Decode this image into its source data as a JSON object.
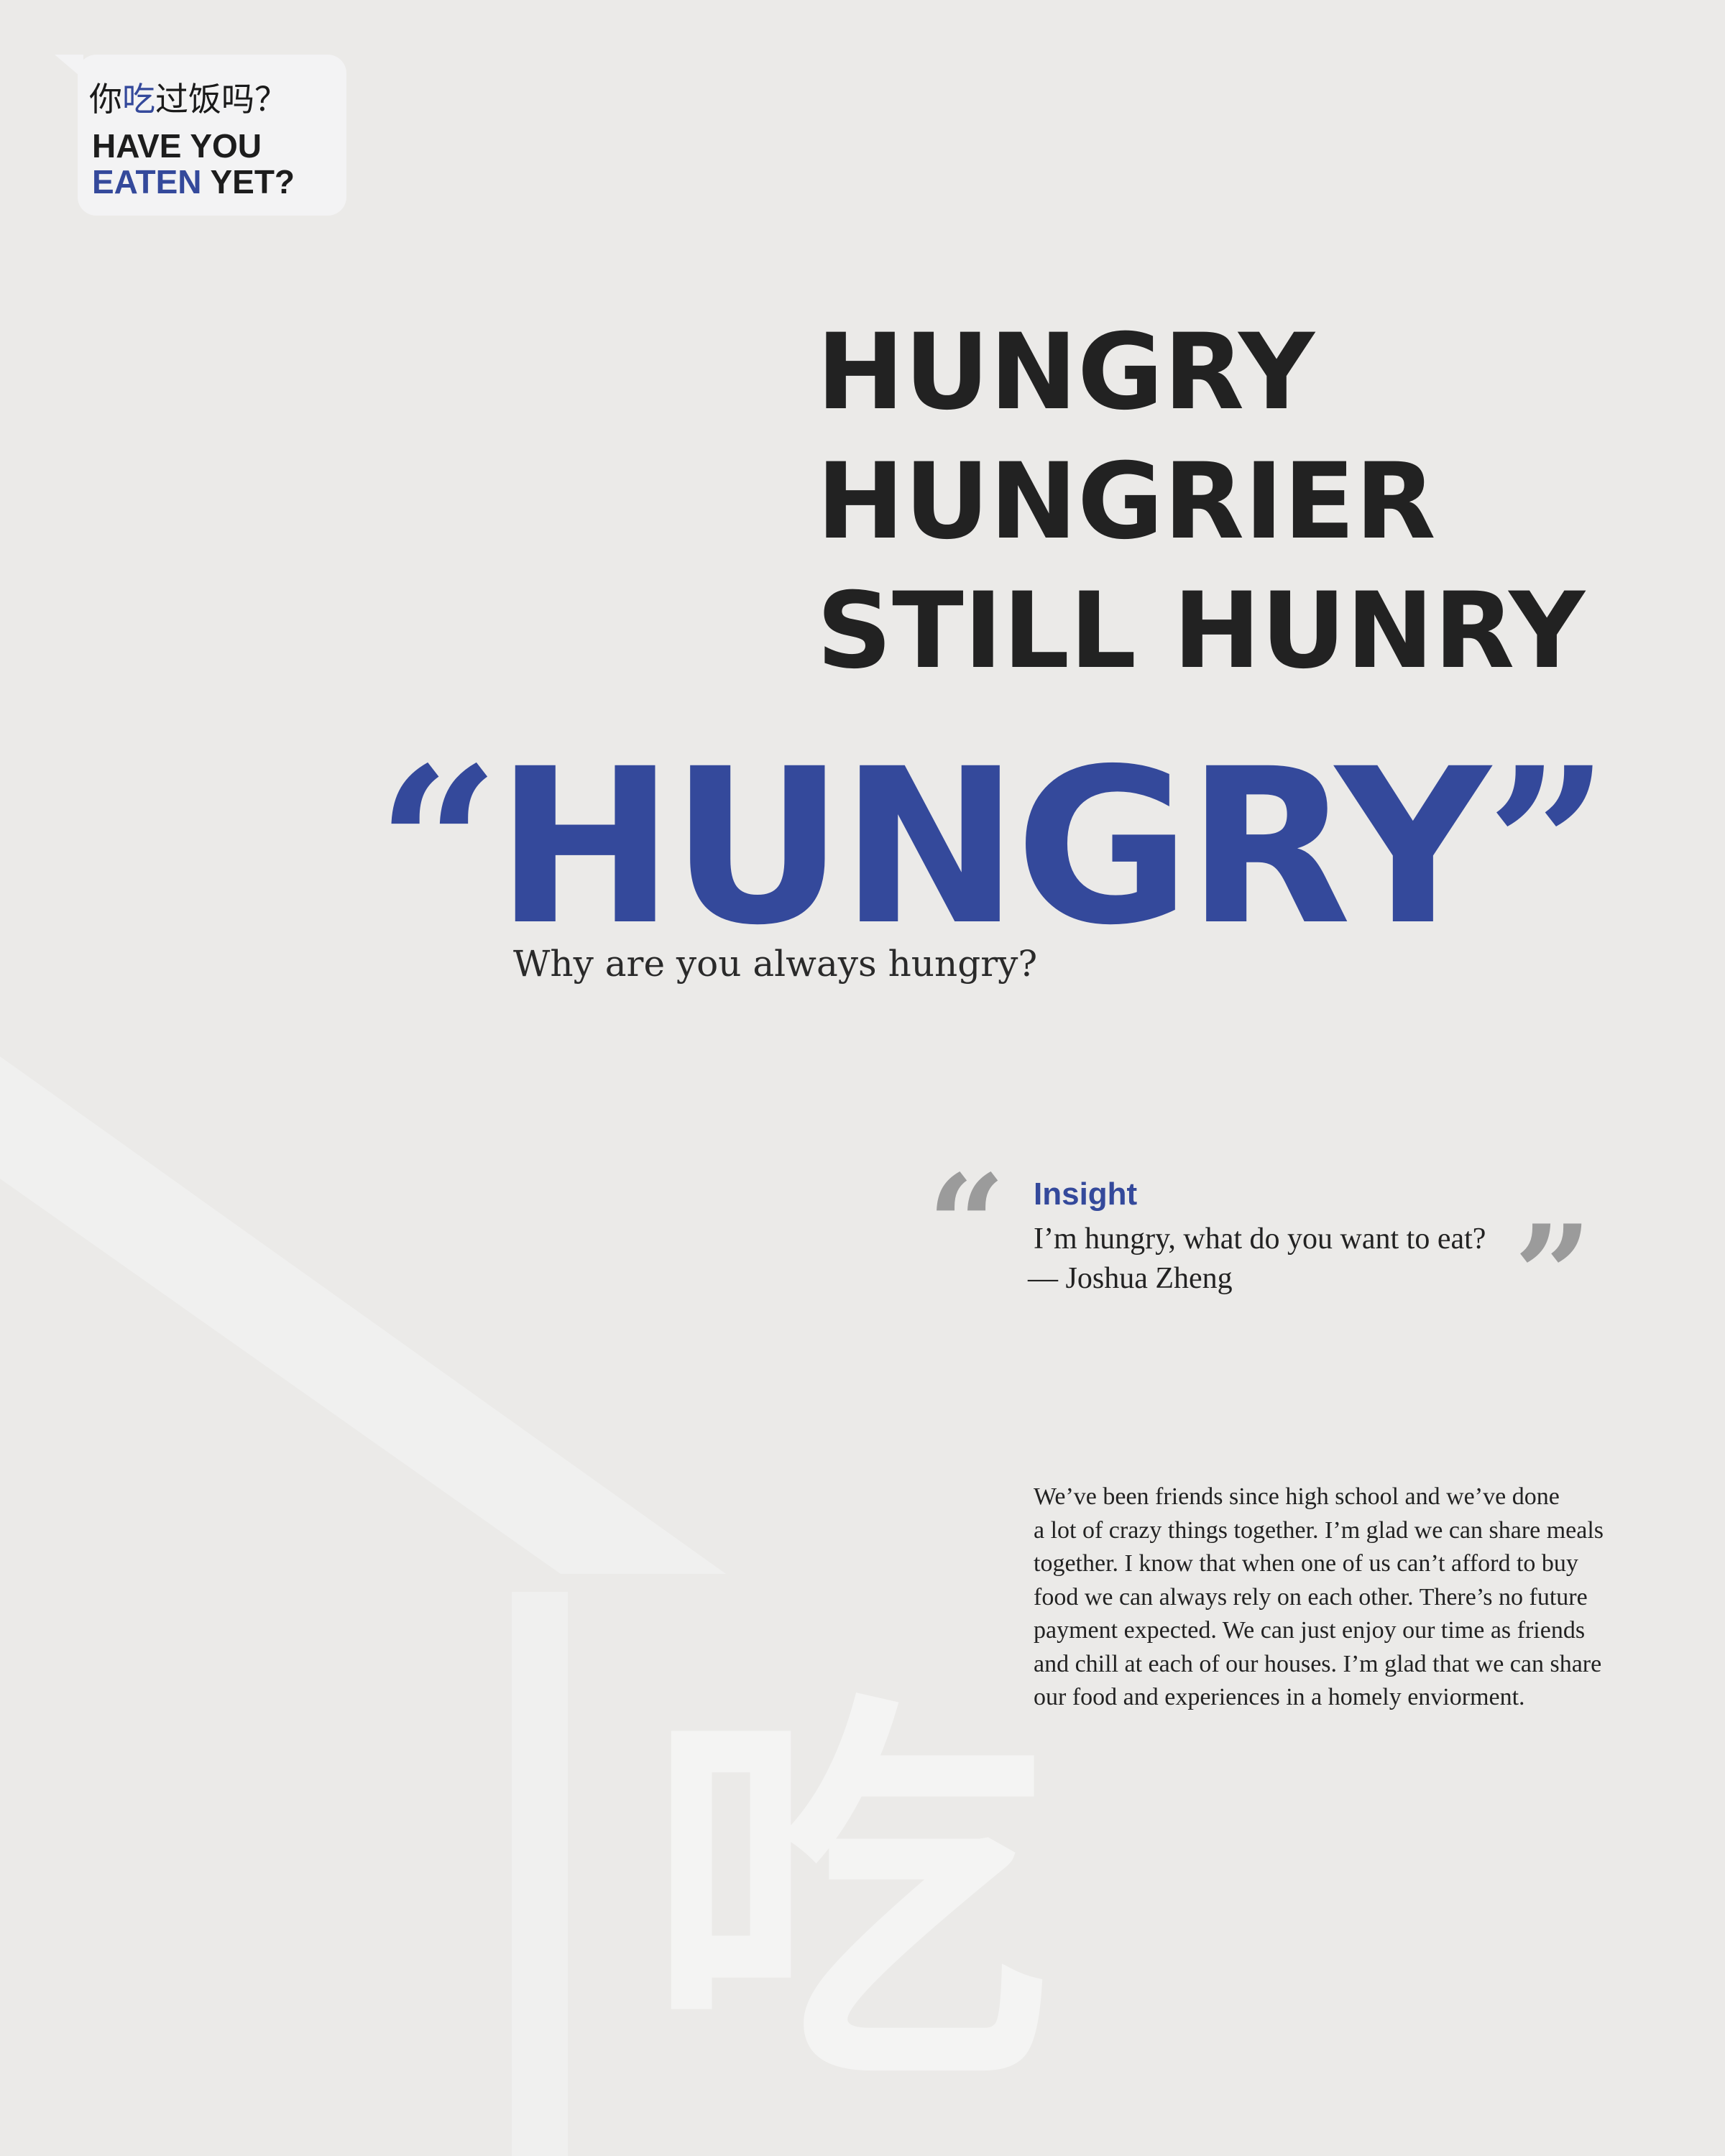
{
  "logo": {
    "chinese_parts": [
      "你",
      "吃",
      "过饭吗？"
    ],
    "english_line1": "HAVE YOU",
    "english_line2_accent": "EATEN",
    "english_line2_rest": " YET?"
  },
  "headline_stack": [
    "HUNGRY",
    "HUNGRIER",
    "STILL HUNRY"
  ],
  "big_quote": {
    "open_mark": "“",
    "word": "HUNGRY",
    "close_mark": "”"
  },
  "subtitle": "Why are you always hungry?",
  "insight": {
    "open_mark": "“",
    "close_mark": "”",
    "title": "Insight",
    "quote": "I’m hungry, what do you want to eat?",
    "author": "— Joshua Zheng"
  },
  "body_lines": [
    "We’ve been friends since high school and we’ve done",
    "a lot of crazy things together. I’m glad we can share meals",
    "together. I know that when one of us can’t afford to buy",
    "food we can always rely on each other. There’s no future",
    "payment expected. We can just enjoy our time as friends",
    "and chill at each of our houses. I’m glad that we can share",
    "our food and experiences in a homely enviorment."
  ],
  "watermark": "吃",
  "colors": {
    "background": "#ebeae8",
    "accent": "#34499b",
    "text": "#222222",
    "quote_marks": "#9b9b9b"
  }
}
